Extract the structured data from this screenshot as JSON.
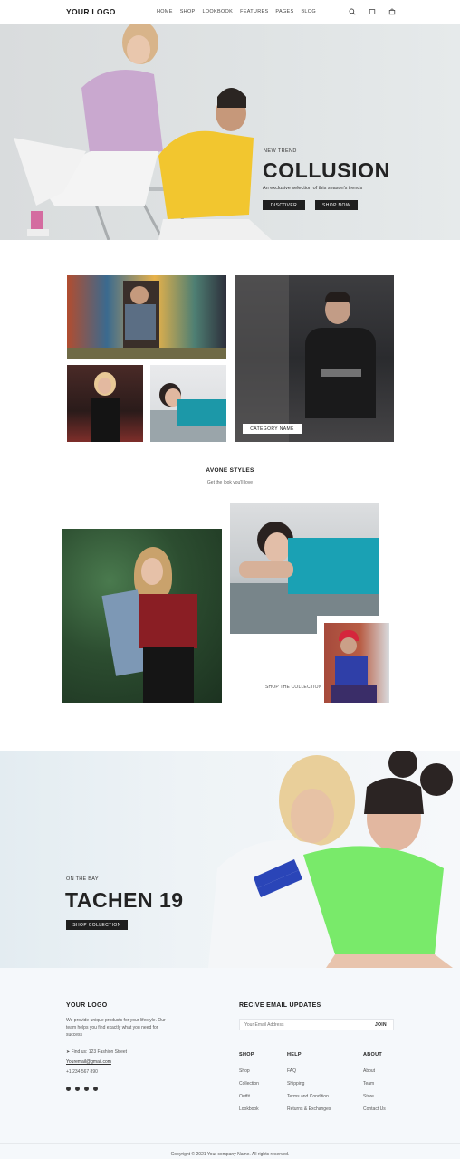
{
  "header": {
    "logo": "YOUR LOGO",
    "nav": [
      "HOME",
      "SHOP",
      "LOOKBOOK",
      "FEATURES",
      "PAGES",
      "BLOG"
    ],
    "icons": [
      "search-icon",
      "heart-icon",
      "cart-icon"
    ]
  },
  "hero": {
    "eyebrow": "NEW TREND",
    "title": "COLLUSION",
    "subtitle": "An exclusive selection of this season's trends",
    "btn_discover": "DISCOVER",
    "btn_shop": "SHOP NOW"
  },
  "categories": {
    "label": "CATEGORY NAME"
  },
  "styles": {
    "title": "AVONE STYLES",
    "subtitle": "Get the look you'll love"
  },
  "collection": {
    "caption": "SHOP THE COLLECTION"
  },
  "promo": {
    "eyebrow": "ON THE BAY",
    "title": "TACHEN 19",
    "button": "SHOP COLLECTION"
  },
  "footer": {
    "logo": "YOUR LOGO",
    "about_text_1": "We provide unique products for your lifestyle. Our",
    "about_text_2": "team helps you find exactly what you need for",
    "about_text_3": "success",
    "address": "Find us: 123 Fashion Street",
    "email": "Youremail@gmail.com",
    "phone": "+1 234 567 890",
    "newsletter_title": "RECIVE EMAIL UPDATES",
    "email_placeholder": "Your Email Address",
    "join": "JOIN",
    "shop_head": "SHOP",
    "shop_links": [
      "Shop",
      "Collection",
      "Outfit",
      "Lookbook"
    ],
    "help_head": "HELP",
    "help_links": [
      "FAQ",
      "Shipping",
      "Terms and Condition",
      "Returns & Exchanges"
    ],
    "about_head": "ABOUT",
    "about_links": [
      "About",
      "Team",
      "Store",
      "Contact Us"
    ],
    "copyright": "Copyright © 2021 Your company Name. All rights reserved."
  },
  "colors": {
    "dark": "#1f1f1f",
    "hero_bg": "#dfe3e4",
    "promo_bg": "#eef3f6",
    "footer_bg": "#f5f8fb"
  }
}
